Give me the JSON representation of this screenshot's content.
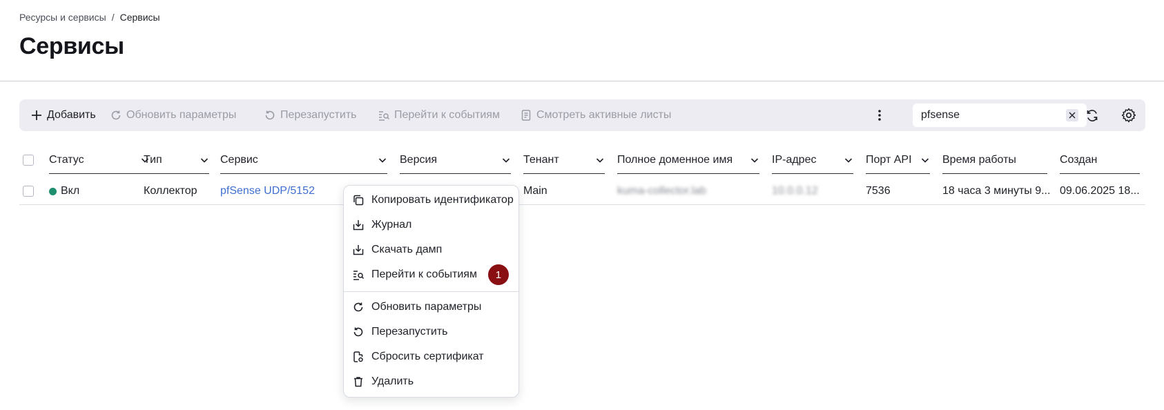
{
  "breadcrumb": {
    "parent": "Ресурсы и сервисы",
    "separator": "/",
    "current": "Сервисы"
  },
  "page_title": "Сервисы",
  "toolbar": {
    "add": "Добавить",
    "update_params": "Обновить параметры",
    "restart": "Перезапустить",
    "go_to_events": "Перейти к событиям",
    "view_active_lists": "Смотреть активные листы",
    "search_value": "pfsense"
  },
  "table": {
    "headers": {
      "status": "Статус",
      "type": "Тип",
      "service": "Сервис",
      "version": "Версия",
      "tenant": "Тенант",
      "fqdn": "Полное доменное имя",
      "ip": "IP-адрес",
      "api_port": "Порт API",
      "uptime": "Время работы",
      "created": "Создан"
    },
    "rows": [
      {
        "status": "Вкл",
        "type": "Коллектор",
        "service": "pfSense UDP/5152",
        "tenant": "Main",
        "fqdn": "kuma-collector.lab",
        "ip": "10.0.0.12",
        "api_port": "7536",
        "uptime": "18 часа 3 минуты 9...",
        "created": "09.06.2025 18..."
      }
    ]
  },
  "context_menu": {
    "items": [
      {
        "label": "Копировать идентификатор",
        "icon": "copy-icon"
      },
      {
        "label": "Журнал",
        "icon": "download-icon"
      },
      {
        "label": "Скачать дамп",
        "icon": "download-icon"
      },
      {
        "label": "Перейти к событиям",
        "icon": "events-search-icon",
        "badge": "1"
      },
      {
        "label": "Обновить параметры",
        "icon": "refresh-icon"
      },
      {
        "label": "Перезапустить",
        "icon": "restart-icon"
      },
      {
        "label": "Сбросить сертификат",
        "icon": "certificate-icon"
      },
      {
        "label": "Удалить",
        "icon": "trash-icon"
      }
    ]
  },
  "colors": {
    "status_on": "#1e8f6e",
    "link": "#3f6fd1",
    "badge": "#8a0f12",
    "toolbar_bg": "#ececf2"
  }
}
